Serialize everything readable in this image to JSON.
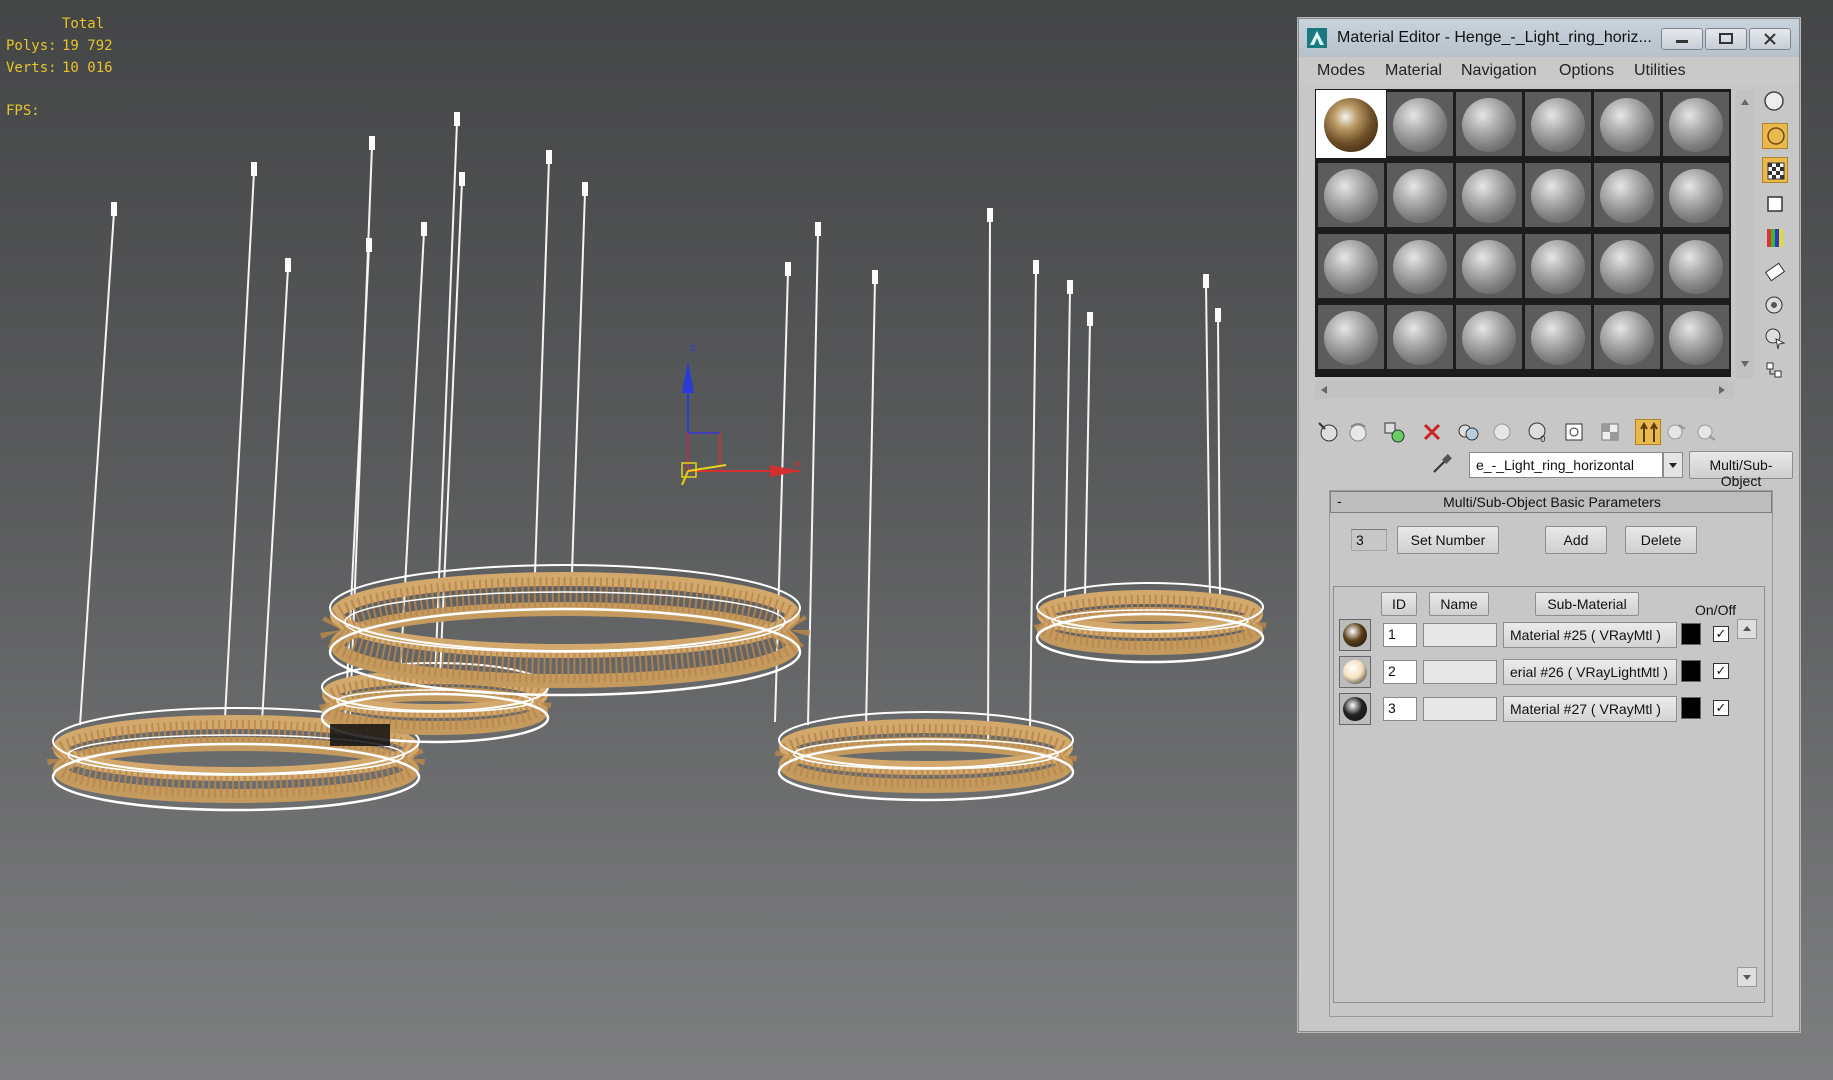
{
  "viewport": {
    "stats": {
      "total_label": "Total",
      "polys_label": "Polys:",
      "polys_value": "19 792",
      "verts_label": "Verts:",
      "verts_value": "10 016",
      "fps_label": "FPS:"
    },
    "gizmo": {
      "z_label": "z",
      "x_label": "x"
    }
  },
  "material_editor": {
    "title": "Material Editor - Henge_-_Light_ring_horiz...",
    "menu": [
      "Modes",
      "Material",
      "Navigation",
      "Options",
      "Utilities"
    ],
    "material_name": "e_-_Light_ring_horizontal",
    "material_type": "Multi/Sub-Object",
    "rollout_title": "Multi/Sub-Object Basic Parameters",
    "rollout_toggle": "-",
    "count_value": "3",
    "set_number": "Set Number",
    "add": "Add",
    "delete": "Delete",
    "headers": {
      "id": "ID",
      "name": "Name",
      "sub_material": "Sub-Material",
      "on_off": "On/Off"
    },
    "rows": [
      {
        "id": "1",
        "name": "",
        "sub_material": "Material #25  ( VRayMtl )",
        "enabled": "✓",
        "swatch": "#5a3d1a"
      },
      {
        "id": "2",
        "name": "",
        "sub_material": "erial #26  ( VRayLightMtl )",
        "enabled": "✓",
        "swatch": "#f4e0c0"
      },
      {
        "id": "3",
        "name": "",
        "sub_material": "Material #27  ( VRayMtl )",
        "enabled": "✓",
        "swatch": "#222222"
      }
    ],
    "colors": {
      "active_tool": "#e9b84e",
      "panel": "#c7c7c7"
    }
  }
}
